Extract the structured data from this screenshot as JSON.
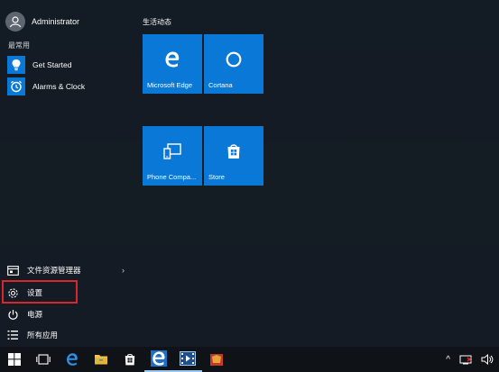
{
  "user": {
    "name": "Administrator"
  },
  "most_used": {
    "label": "最常用",
    "apps": [
      {
        "label": "Get Started",
        "icon": "lightbulb-icon"
      },
      {
        "label": "Alarms & Clock",
        "icon": "alarm-clock-icon"
      }
    ]
  },
  "system": {
    "items": [
      {
        "label": "文件资源管理器",
        "icon": "folder-icon",
        "has_submenu": true
      },
      {
        "label": "设置",
        "icon": "gear-icon",
        "highlighted": true
      },
      {
        "label": "电源",
        "icon": "power-icon"
      },
      {
        "label": "所有应用",
        "icon": "list-icon"
      }
    ]
  },
  "tiles": {
    "group_title": "生活动态",
    "items": [
      {
        "label": "Microsoft Edge",
        "icon": "edge-icon"
      },
      {
        "label": "Cortana",
        "icon": "cortana-icon"
      },
      {
        "label": "Phone Compa...",
        "icon": "phone-companion-icon"
      },
      {
        "label": "Store",
        "icon": "store-icon"
      }
    ]
  },
  "taskbar": {
    "buttons": [
      "start-icon",
      "task-view-icon",
      "edge-icon",
      "file-explorer-icon",
      "store-icon",
      "edge-icon",
      "media-icon",
      "app-icon"
    ],
    "tray": [
      "chevron-up-icon",
      "network-icon",
      "volume-icon"
    ]
  },
  "colors": {
    "tile": "#0a78d7",
    "highlight": "#d9262a",
    "taskbar": "#0f1318"
  }
}
